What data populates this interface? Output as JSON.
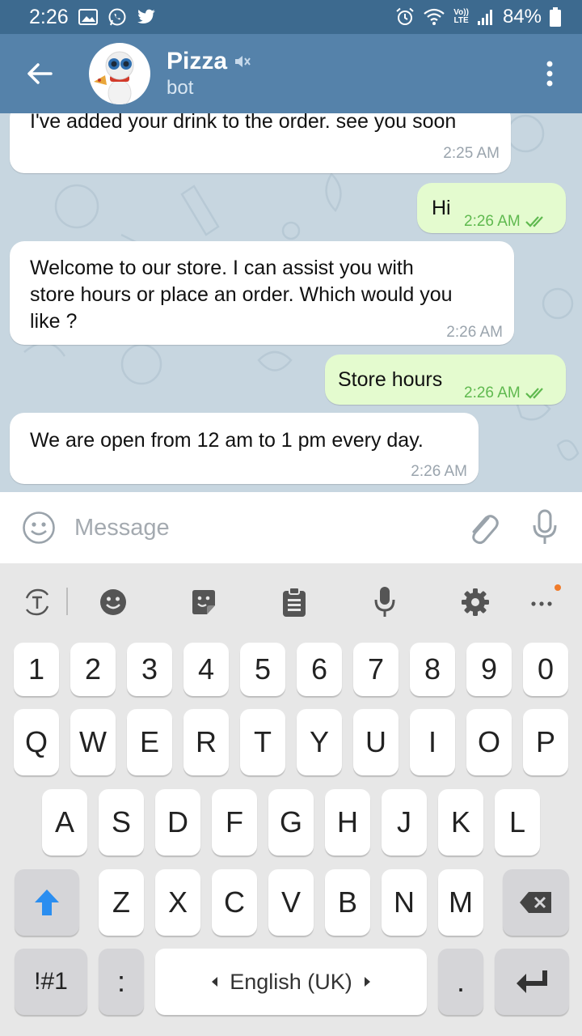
{
  "status_bar": {
    "time": "2:26",
    "battery": "84%",
    "lte_top": "Vo))",
    "lte_bottom": "LTE"
  },
  "header": {
    "title": "Pizza",
    "subtitle": "bot"
  },
  "messages": [
    {
      "direction": "in",
      "text": "I've added your drink to the order. see you soon",
      "time": "2:25 AM"
    },
    {
      "direction": "out",
      "text": "Hi",
      "time": "2:26 AM"
    },
    {
      "direction": "in",
      "lines": [
        "Welcome to our store. I can assist you with",
        "store hours or place an order. Which would you",
        "like ?"
      ],
      "time": "2:26 AM"
    },
    {
      "direction": "out",
      "text": "Store hours",
      "time": "2:26 AM"
    },
    {
      "direction": "in",
      "text": "We are open from 12 am to 1 pm every day.",
      "time": "2:26 AM"
    }
  ],
  "composer": {
    "placeholder": "Message"
  },
  "keyboard": {
    "number_row": [
      "1",
      "2",
      "3",
      "4",
      "5",
      "6",
      "7",
      "8",
      "9",
      "0"
    ],
    "row1": [
      "Q",
      "W",
      "E",
      "R",
      "T",
      "Y",
      "U",
      "I",
      "O",
      "P"
    ],
    "row2": [
      "A",
      "S",
      "D",
      "F",
      "G",
      "H",
      "J",
      "K",
      "L"
    ],
    "row3": [
      "Z",
      "X",
      "C",
      "V",
      "B",
      "N",
      "M"
    ],
    "symbols_label": "!#1",
    "colon_label": ":",
    "space_label": "English (UK)",
    "period_label": ".",
    "colors": {
      "accent_blue": "#2b8ef0",
      "dot_orange": "#f07b2a"
    }
  },
  "colors": {
    "status_bar": "#3d6a8f",
    "app_bar": "#5582aa",
    "chat_bg": "#c7d6e0",
    "outgoing_bubble": "#e4fbcf",
    "incoming_bubble": "#ffffff",
    "read_check": "#5fb94f"
  }
}
